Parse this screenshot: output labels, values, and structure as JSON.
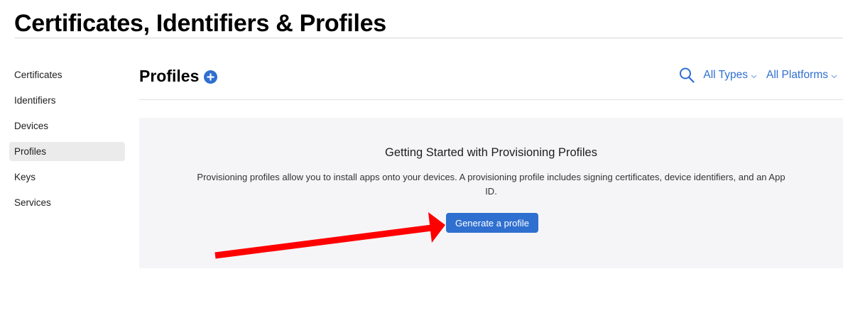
{
  "page": {
    "title": "Certificates, Identifiers & Profiles"
  },
  "sidebar": {
    "items": [
      {
        "label": "Certificates",
        "active": false
      },
      {
        "label": "Identifiers",
        "active": false
      },
      {
        "label": "Devices",
        "active": false
      },
      {
        "label": "Profiles",
        "active": true
      },
      {
        "label": "Keys",
        "active": false
      },
      {
        "label": "Services",
        "active": false
      }
    ]
  },
  "section": {
    "title": "Profiles",
    "add_icon": "plus-circle-icon",
    "search_icon": "search-icon",
    "filters": {
      "types_label": "All Types",
      "platforms_label": "All Platforms"
    }
  },
  "getting_started": {
    "title": "Getting Started with Provisioning Profiles",
    "description": "Provisioning profiles allow you to install apps onto your devices. A provisioning profile includes signing certificates, device identifiers, and an App ID.",
    "button_label": "Generate a profile"
  },
  "annotation": {
    "type": "arrow",
    "color": "#ff0000",
    "points_to": "generate-profile-button"
  },
  "colors": {
    "accent": "#2f6fd0",
    "panel_bg": "#f5f5f7",
    "active_item_bg": "#ebebeb"
  }
}
